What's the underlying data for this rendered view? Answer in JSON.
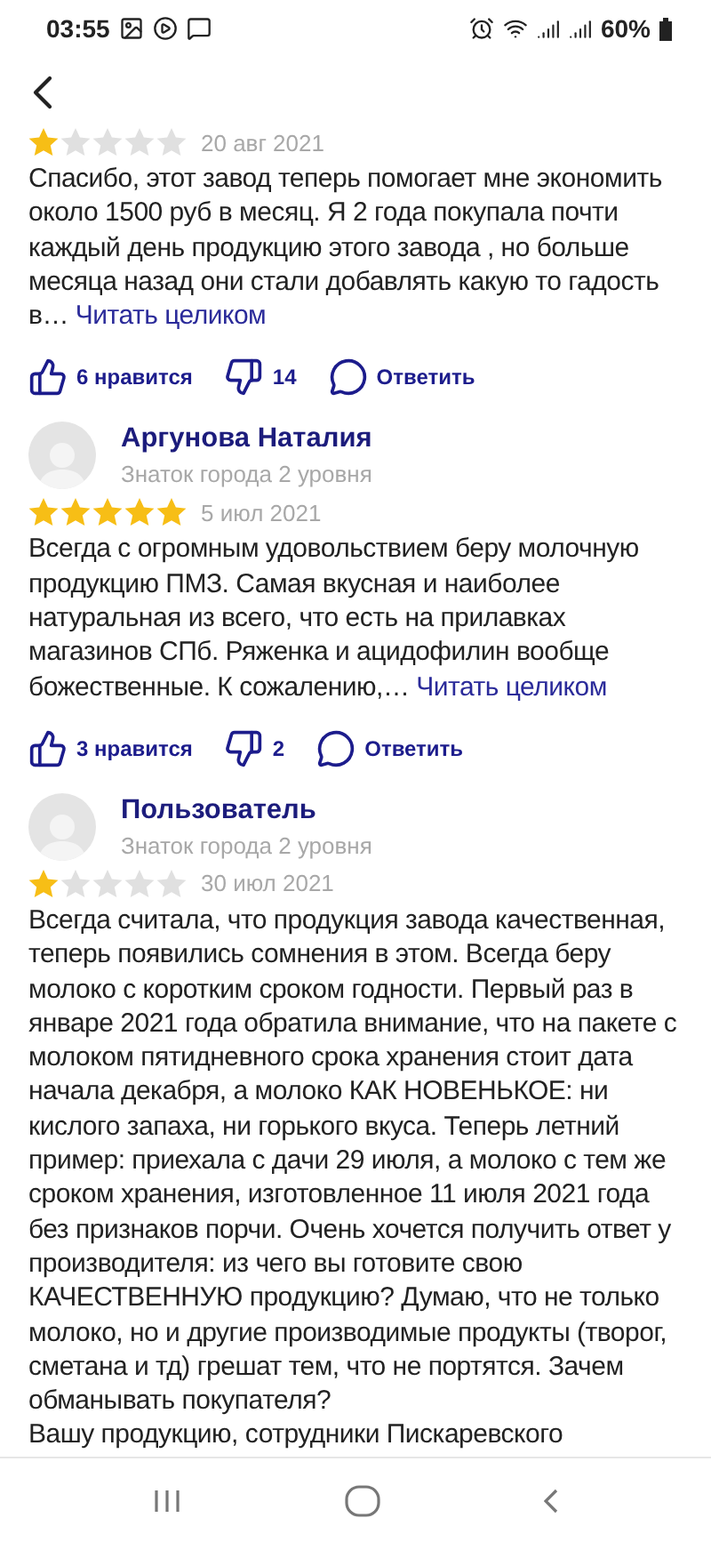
{
  "status_bar": {
    "time": "03:55",
    "battery": "60%"
  },
  "reviews": [
    {
      "stars": 1,
      "date": "20 авг 2021",
      "paragraphs": [
        "Спасибо, этот завод теперь помогает мне экономить около 1500 руб в месяц. Я 2 года покупала почти каждый день продукцию этого завода , но больше месяца назад они стали добавлять какую то гадость в…"
      ],
      "read_more": "Читать целиком",
      "likes": "6 нравится",
      "dislikes": "14",
      "reply": "Ответить"
    },
    {
      "author": "Аргунова Наталия",
      "level": "Знаток города 2 уровня",
      "stars": 5,
      "date": "5 июл 2021",
      "paragraphs": [
        "Всегда с огромным удовольствием беру молочную продукцию ПМЗ. Самая вкусная и наиболее натуральная из всего, что есть на прилавках магазинов СПб. Ряженка и ацидофилин вообще божественные. К сожалению,…"
      ],
      "read_more": "Читать целиком",
      "likes": "3 нравится",
      "dislikes": "2",
      "reply": "Ответить"
    },
    {
      "author": "Пользователь",
      "level": "Знаток города 2 уровня",
      "stars": 1,
      "date": "30 июл 2021",
      "paragraphs": [
        "Всегда считала, что продукция завода качественная, теперь появились сомнения в этом. Всегда беру молоко с коротким сроком годности. Первый раз в январе 2021 года обратила внимание, что на пакете с молоком пятидневного срока хранения стоит дата начала декабря, а молоко КАК НОВЕНЬКОЕ: ни кислого запаха, ни горького вкуса. Теперь летний пример: приехала с дачи 29 июля, а молоко с тем же сроком хранения, изготовленное 11 июля 2021 года без признаков порчи. Очень хочется получить ответ у производителя: из чего вы готовите свою КАЧЕСТВЕННУЮ продукцию? Думаю, что не только молоко, но и другие производимые продукты (творог, сметана и тд) грешат тем, что не портятся. Зачем обманывать покупателя?",
        "Вашу продукцию, сотрудники Пискаревского"
      ]
    }
  ]
}
